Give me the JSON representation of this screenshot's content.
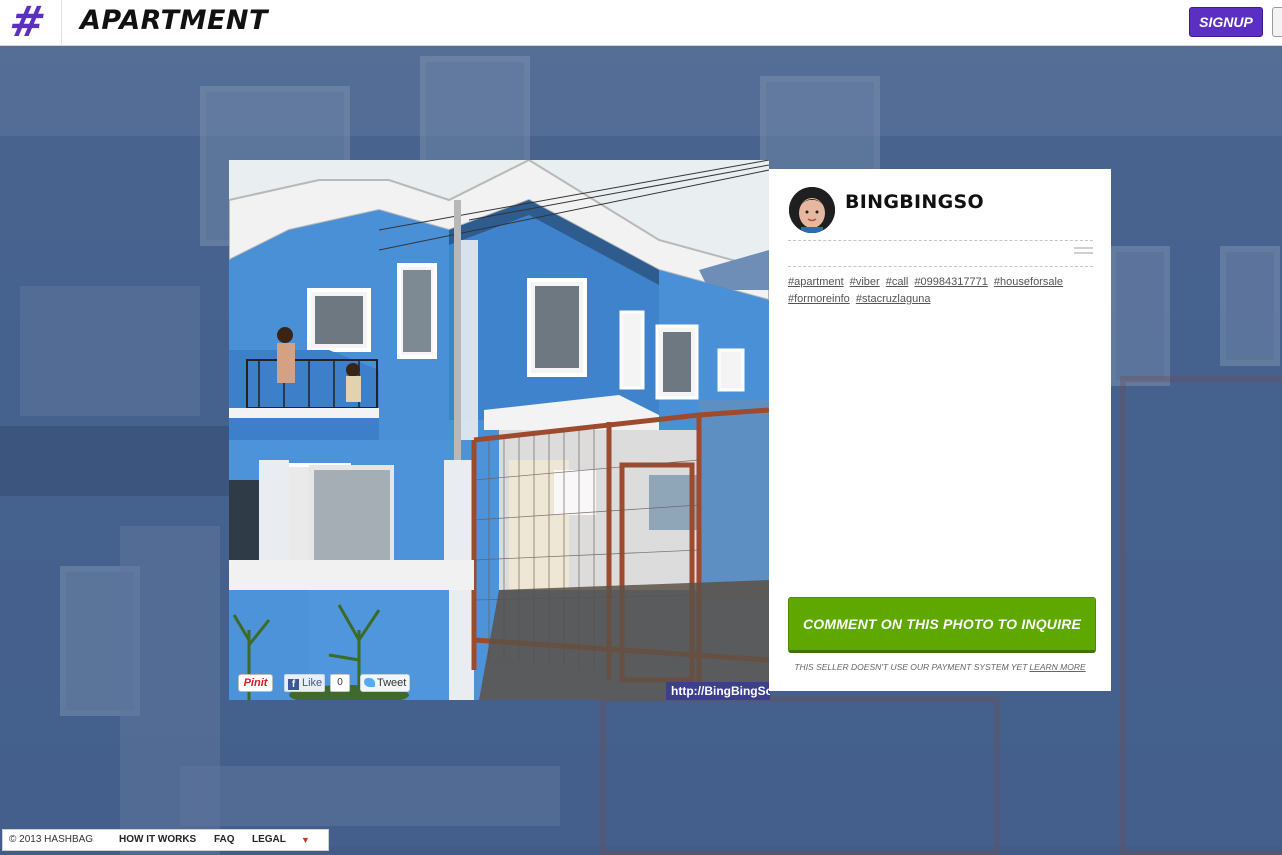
{
  "header": {
    "logo_glyph": "#",
    "title": "APARTMENT",
    "signup_label": "SIGNUP",
    "brand_color": "#5b2fc1"
  },
  "photo": {
    "watermark": "http://BingBingSo",
    "share": {
      "pin_label": "Pinit",
      "like_label": "Like",
      "like_count": "0",
      "tweet_label": "Tweet"
    }
  },
  "panel": {
    "username": "BINGBINGSO",
    "tags": [
      "#apartment",
      "#viber",
      "#call",
      "#09984317771",
      "#houseforsale",
      "#formoreinfo",
      "#stacruzlaguna"
    ],
    "inquire_label": "COMMENT ON THIS PHOTO TO INQUIRE",
    "inquire_color": "#5ea800",
    "payment_note": "THIS SELLER DOESN'T USE OUR PAYMENT SYSTEM YET",
    "learn_more": "LEARN MORE"
  },
  "footer": {
    "copyright": "© 2013 HASHBAG",
    "links": [
      "HOW IT WORKS",
      "FAQ",
      "LEGAL"
    ],
    "caret": "▼"
  }
}
